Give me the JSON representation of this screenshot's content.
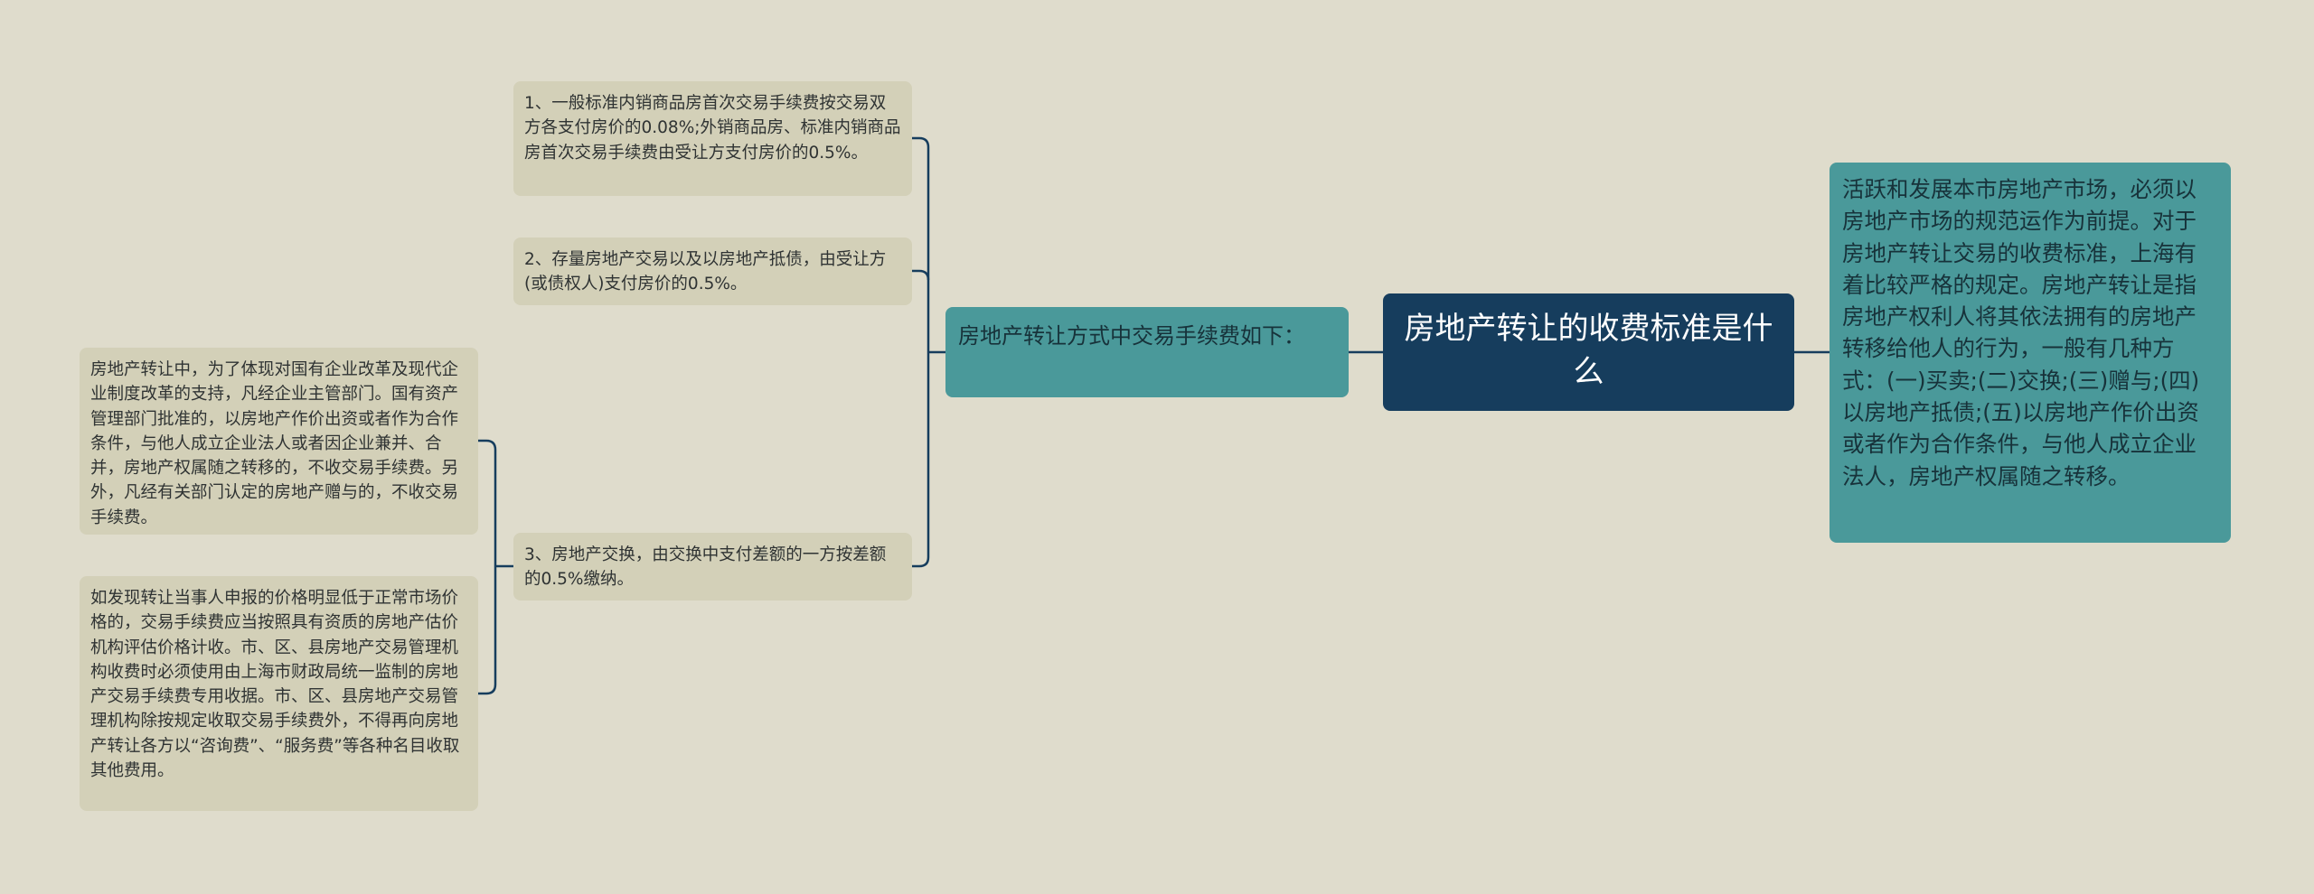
{
  "root": {
    "title": "房地产转让的收费标准是什么"
  },
  "right_node": {
    "text": "活跃和发展本市房地产市场，必须以房地产市场的规范运作为前提。对于房地产转让交易的收费标准，上海有着比较严格的规定。房地产转让是指房地产权利人将其依法拥有的房地产转移给他人的行为，一般有几种方式：(一)买卖;(二)交换;(三)赠与;(四)以房地产抵债;(五)以房地产作价出资或者作为合作条件，与他人成立企业法人，房地产权属随之转移。"
  },
  "mid_node": {
    "text": "房地产转让方式中交易手续费如下："
  },
  "leaves": [
    "1、一般标准内销商品房首次交易手续费按交易双方各支付房价的0.08%;外销商品房、标准内销商品房首次交易手续费由受让方支付房价的0.5%。",
    "2、存量房地产交易以及以房地产抵债，由受让方(或债权人)支付房价的0.5%。",
    "3、房地产交换，由交换中支付差额的一方按差额的0.5%缴纳。"
  ],
  "sub_leaves": [
    "房地产转让中，为了体现对国有企业改革及现代企业制度改革的支持，凡经企业主管部门。国有资产管理部门批准的，以房地产作价出资或者作为合作条件，与他人成立企业法人或者因企业兼并、合并，房地产权属随之转移的，不收交易手续费。另外，凡经有关部门认定的房地产赠与的，不收交易手续费。",
    "如发现转让当事人申报的价格明显低于正常市场价格的，交易手续费应当按照具有资质的房地产估价机构评估价格计收。市、区、县房地产交易管理机构收费时必须使用由上海市财政局统一监制的房地产交易手续费专用收据。市、区、县房地产交易管理机构除按规定收取交易手续费外，不得再向房地产转让各方以“咨询费”、“服务费”等各种名目收取其他费用。"
  ],
  "colors": {
    "background": "#dfdccc",
    "root": "#163d5d",
    "branch": "#4a999a",
    "leaf": "#d3d0b8",
    "connector": "#163d5d"
  }
}
